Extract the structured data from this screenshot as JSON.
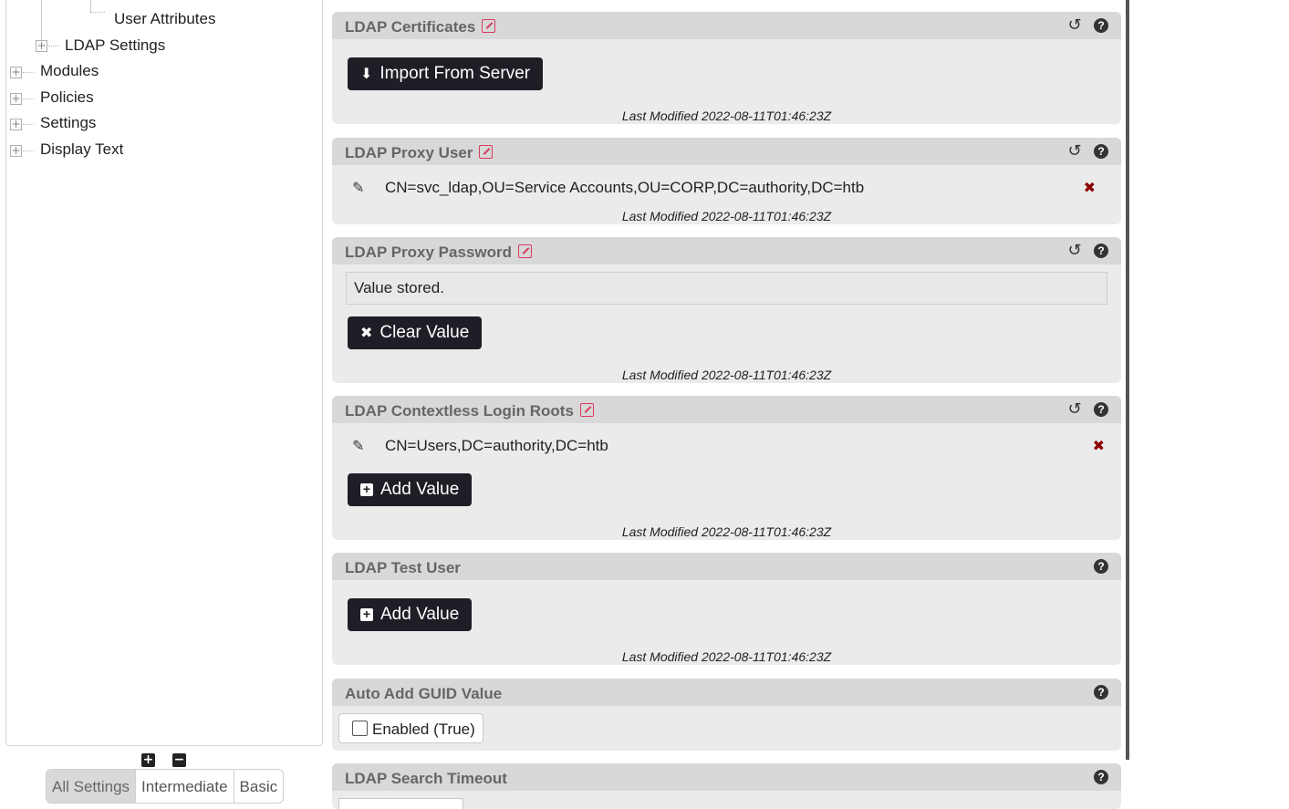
{
  "tree": {
    "items": [
      {
        "label": "User Attributes"
      },
      {
        "label": "LDAP Settings"
      },
      {
        "label": "Modules"
      },
      {
        "label": "Policies"
      },
      {
        "label": "Settings"
      },
      {
        "label": "Display Text"
      }
    ],
    "expand_all_label": "+",
    "collapse_all_label": "−"
  },
  "levels": {
    "tabs": [
      {
        "label": "All Settings",
        "active": true
      },
      {
        "label": "Intermediate",
        "active": false
      },
      {
        "label": "Basic",
        "active": false
      }
    ]
  },
  "settings": {
    "certificates": {
      "title": "LDAP Certificates",
      "button": "Import From Server",
      "modified": "Last Modified 2022-08-11T01:46:23Z"
    },
    "proxy_user": {
      "title": "LDAP Proxy User",
      "value": "CN=svc_ldap,OU=Service Accounts,OU=CORP,DC=authority,DC=htb",
      "modified": "Last Modified 2022-08-11T01:46:23Z"
    },
    "proxy_password": {
      "title": "LDAP Proxy Password",
      "stored": "Value stored.",
      "button": "Clear Value",
      "modified": "Last Modified 2022-08-11T01:46:23Z"
    },
    "login_roots": {
      "title": "LDAP Contextless Login Roots",
      "value": "CN=Users,DC=authority,DC=htb",
      "button": "Add Value",
      "modified": "Last Modified 2022-08-11T01:46:23Z"
    },
    "test_user": {
      "title": "LDAP Test User",
      "button": "Add Value",
      "modified": "Last Modified 2022-08-11T01:46:23Z"
    },
    "auto_guid": {
      "title": "Auto Add GUID Value",
      "checkbox_label": "Enabled (True)",
      "checked": false
    },
    "search_timeout": {
      "title": "LDAP Search Timeout"
    }
  },
  "icons": {
    "reset": "undo-icon",
    "help": "question-icon",
    "edit": "pencil-square-icon",
    "remove": "x-icon"
  },
  "colors": {
    "header_bg": "#d8d8d8",
    "panel_bg": "#ebebeb",
    "button_bg": "#1e1e26",
    "edit_accent": "#d83a5c",
    "remove_red": "#8b0000"
  }
}
